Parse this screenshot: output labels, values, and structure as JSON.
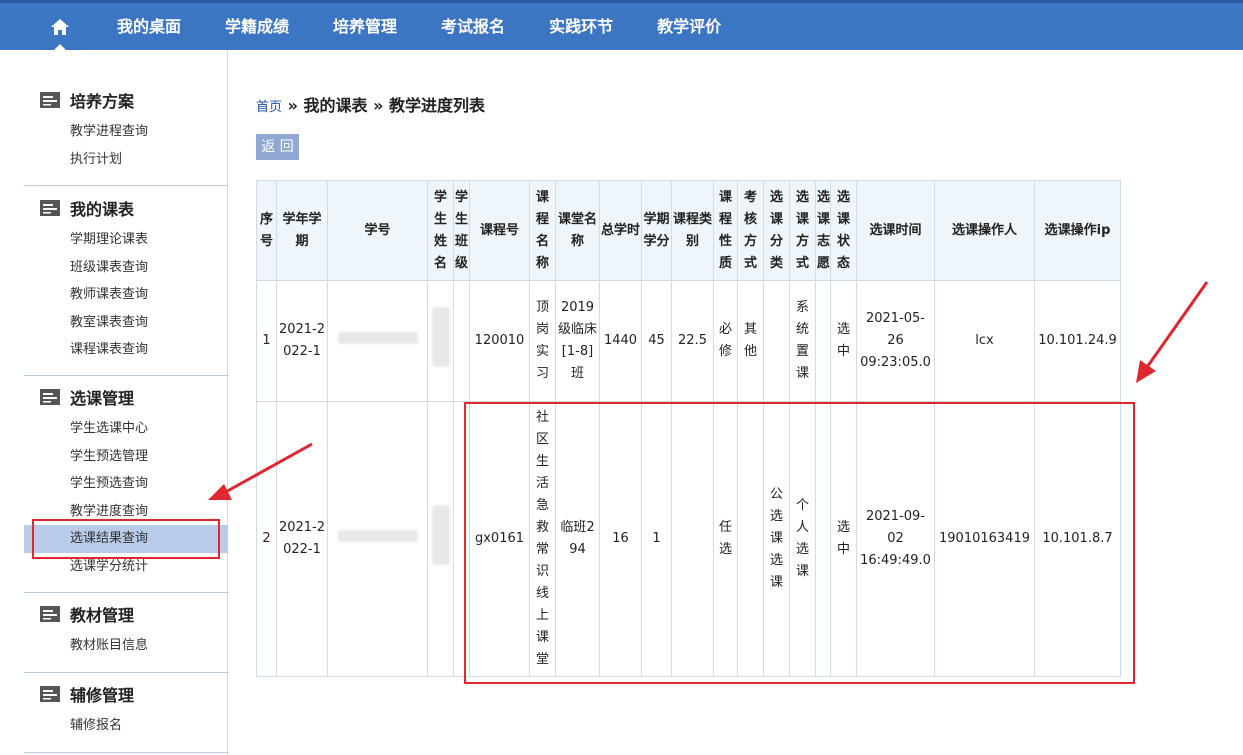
{
  "nav": {
    "home_icon": "home-icon",
    "items": [
      "我的桌面",
      "学籍成绩",
      "培养管理",
      "考试报名",
      "实践环节",
      "教学评价"
    ]
  },
  "sidebar": {
    "sections": [
      {
        "title": "培养方案",
        "items": [
          "教学进程查询",
          "执行计划"
        ]
      },
      {
        "title": "我的课表",
        "items": [
          "学期理论课表",
          "班级课表查询",
          "教师课表查询",
          "教室课表查询",
          "课程课表查询"
        ]
      },
      {
        "title": "选课管理",
        "items": [
          "学生选课中心",
          "学生预选管理",
          "学生预选查询",
          "教学进度查询",
          "选课结果查询",
          "选课学分统计"
        ],
        "active": "选课结果查询"
      },
      {
        "title": "教材管理",
        "items": [
          "教材账目信息"
        ]
      },
      {
        "title": "辅修管理",
        "items": [
          "辅修报名"
        ]
      }
    ]
  },
  "breadcrumb": {
    "home": "首页",
    "sep": " » ",
    "level1": "我的课表",
    "level2": "教学进度列表"
  },
  "back_button": "返 回",
  "table": {
    "headers": [
      "序号",
      "学年学期",
      "学号",
      "学生姓名",
      "学生班级",
      "课程号",
      "课程名称",
      "课堂名称",
      "总学时",
      "学期学分",
      "课程类别",
      "课程性质",
      "考核方式",
      "选课分类",
      "选课方式",
      "选课志愿",
      "选课状态",
      "选课时间",
      "选课操作人",
      "选课操作ip"
    ],
    "rows": [
      [
        "1",
        "2021-2022-1",
        "",
        "",
        "",
        "120010",
        "顶岗实习",
        "2019级临床[1-8]班",
        "1440",
        "45",
        "22.5",
        "必修",
        "其他",
        "",
        "系统置课",
        "",
        "选中",
        "2021-05-26 09:23:05.0",
        "lcx",
        "10.101.24.9"
      ],
      [
        "2",
        "2021-2022-1",
        "",
        "",
        "",
        "gx0161",
        "社区生活急救常识线上课堂",
        "临班294",
        "16",
        "1",
        "",
        "任选",
        "",
        "公选课选课",
        "个人选课",
        "",
        "选中",
        "2021-09-02 16:49:49.0",
        "19010163419",
        "10.101.8.7"
      ]
    ]
  },
  "colors": {
    "topbar": "#3c75c2",
    "header_bg": "#eef6fb",
    "active_item": "#b8cbe8",
    "annotation": "#e0262e"
  }
}
